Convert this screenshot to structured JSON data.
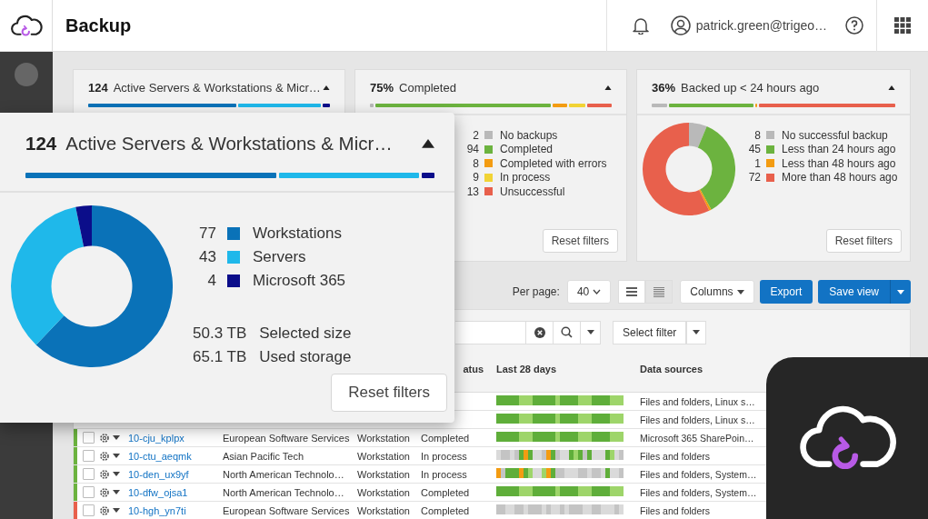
{
  "header": {
    "title": "Backup",
    "user": "patrick.green@trigeo…"
  },
  "summary_cards": [
    {
      "count": "124",
      "title": "Active Servers & Workstations & Micr…",
      "expanded": true
    },
    {
      "count": "75%",
      "title": "Completed",
      "expanded": true,
      "legend": [
        {
          "count": "2",
          "label": "No backups",
          "color": "#b9b9b9"
        },
        {
          "count": "94",
          "label": "Completed",
          "color": "#6cb33f"
        },
        {
          "count": "8",
          "label": "Completed with errors",
          "color": "#f39c12"
        },
        {
          "count": "9",
          "label": "In process",
          "color": "#f1d335"
        },
        {
          "count": "13",
          "label": "Unsuccessful",
          "color": "#e8604c"
        }
      ],
      "reset_button": "Reset filters"
    },
    {
      "count": "36%",
      "title": "Backed up < 24 hours ago",
      "expanded": true,
      "chart_data": {
        "type": "donut",
        "categories": [
          "No successful backup",
          "Less than 24 hours ago",
          "Less than 48 hours ago",
          "More than 48 hours ago"
        ],
        "values": [
          6.3,
          35.7,
          0.8,
          57.2
        ]
      },
      "legend": [
        {
          "count": "8",
          "color": "#b9b9b9"
        },
        {
          "count": "45",
          "color": "#6cb33f"
        },
        {
          "count": "1",
          "color": "#f39c12"
        },
        {
          "count": "72",
          "color": "#e8604c"
        }
      ],
      "reset_button": "Reset filters"
    }
  ],
  "toolbar": {
    "per_page_label": "Per page:",
    "per_page": "40",
    "view_modes": [
      {
        "kind": "list",
        "selected": false
      },
      {
        "kind": "compact",
        "selected": true
      }
    ],
    "columns_button": "Columns",
    "export_button": "Export",
    "save_button": "Save view"
  },
  "filters": {
    "select_filter": "Select filter"
  },
  "table": {
    "columns": [
      "atus",
      "Last 28 days",
      "Data sources"
    ],
    "rows": [
      {
        "history": {
          "kind": "healthy"
        },
        "data_sources": "Files and folders, Linux s…"
      },
      {
        "history": {
          "kind": "healthy"
        },
        "data_sources": "Files and folders, Linux s…"
      },
      {
        "color": "#6cb33f",
        "checked": false,
        "name": "10-cju_kplpx",
        "organization": "European Software Services",
        "type": "Workstation",
        "status": "Completed",
        "history": {
          "kind": "healthy"
        },
        "data_sources": "Microsoft 365 SharePoin…"
      },
      {
        "color": "#6cb33f",
        "checked": false,
        "name": "10-ctu_aeqmk",
        "organization": "Asian Pacific Tech",
        "type": "Workstation",
        "status": "In process",
        "history": {
          "kind": "running"
        },
        "data_sources": "Files and folders"
      },
      {
        "color": "#6cb33f",
        "checked": false,
        "name": "10-den_ux9yf",
        "organization": "North American Technolo…",
        "type": "Workstation",
        "status": "In process",
        "history": {
          "kind": "mixed"
        },
        "data_sources": "Files and folders, System…"
      },
      {
        "color": "#6cb33f",
        "checked": false,
        "name": "10-dfw_ojsa1",
        "organization": "North American Technolo…",
        "type": "Workstation",
        "status": "Completed",
        "history": {
          "kind": "healthy"
        },
        "data_sources": "Files and folders, System…"
      },
      {
        "color": "#e8604c",
        "checked": false,
        "name": "10-hgh_yn7ti",
        "organization": "European Software Services",
        "type": "Workstation",
        "status": "Completed",
        "history": {
          "kind": "partial"
        },
        "data_sources": "Files and folders"
      }
    ]
  },
  "zoomed_card": {
    "count": "124",
    "title": "Active Servers & Workstations & Micr…",
    "expanded": true,
    "chart_data": {
      "type": "donut",
      "categories": [
        "Workstations",
        "Servers",
        "Microsoft 365"
      ],
      "values": [
        62.1,
        34.7,
        3.2
      ]
    },
    "legend": [
      {
        "count": "77",
        "color": "#0a72b8"
      },
      {
        "count": "43",
        "color": "#1fb8ea"
      },
      {
        "count": "4",
        "color": "#0b0d8a"
      }
    ],
    "storage": [
      {
        "amount": "50.3 TB",
        "label": "Selected size"
      },
      {
        "amount": "65.1 TB",
        "label": "Used storage"
      }
    ],
    "reset_button": "Reset filters"
  }
}
